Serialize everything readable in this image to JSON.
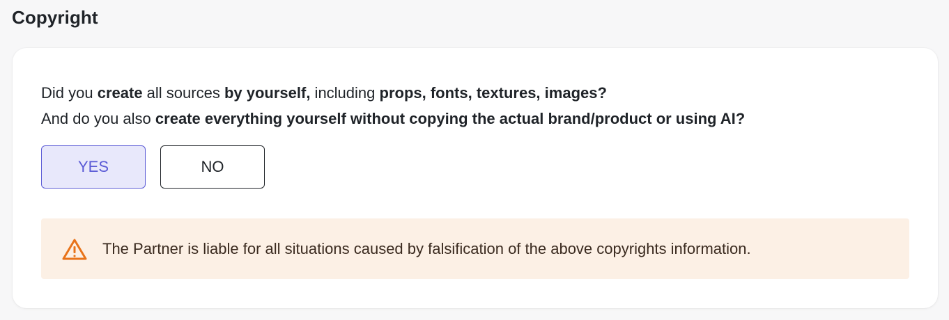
{
  "section": {
    "title": "Copyright"
  },
  "question": {
    "line1": [
      {
        "text": "Did you ",
        "bold": false
      },
      {
        "text": "create",
        "bold": true
      },
      {
        "text": " all sources ",
        "bold": false
      },
      {
        "text": "by yourself,",
        "bold": true
      },
      {
        "text": " including ",
        "bold": false
      },
      {
        "text": "props, fonts, textures, images?",
        "bold": true
      }
    ],
    "line2": [
      {
        "text": "And do you also ",
        "bold": false
      },
      {
        "text": "create everything yourself without copying the actual brand/product or using AI?",
        "bold": true
      }
    ]
  },
  "answers": {
    "yes_label": "YES",
    "no_label": "NO",
    "selected": "YES"
  },
  "warning": {
    "icon": "warning-triangle-icon",
    "text": "The Partner is liable for all situations caused by falsification of the above copyrights information."
  },
  "colors": {
    "accent": "#5b5bd6",
    "selected_bg": "#e8e8fb",
    "warning_bg": "#fcf0e5",
    "warning_icon": "#e8731a"
  }
}
